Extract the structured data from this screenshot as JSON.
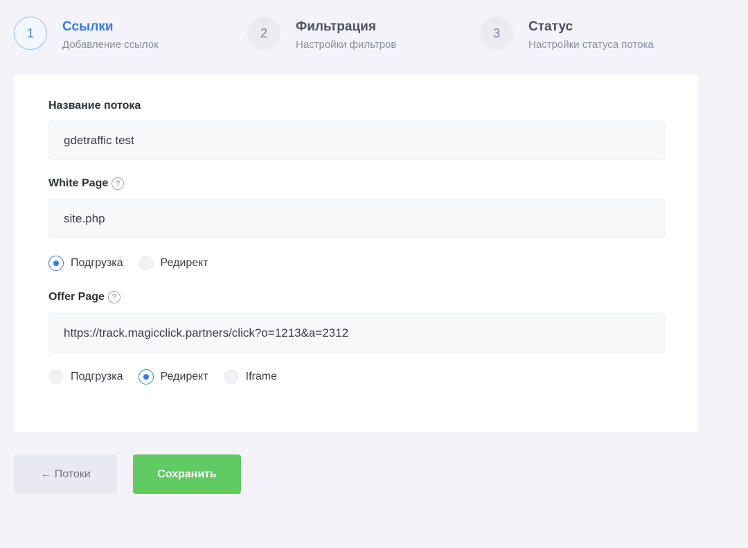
{
  "steps": [
    {
      "number": "1",
      "title": "Ссылки",
      "subtitle": "Добавление ссылок",
      "active": true
    },
    {
      "number": "2",
      "title": "Фильтрация",
      "subtitle": "Настройки фильтров",
      "active": false
    },
    {
      "number": "3",
      "title": "Статус",
      "subtitle": "Настройки статуса потока",
      "active": false
    }
  ],
  "form": {
    "stream_name": {
      "label": "Название потока",
      "value": "gdetraffic test"
    },
    "white_page": {
      "label": "White Page",
      "value": "site.php",
      "options": [
        {
          "label": "Подгрузка",
          "checked": true
        },
        {
          "label": "Редирект",
          "checked": false
        }
      ]
    },
    "offer_page": {
      "label": "Offer Page",
      "value": "https://track.magicclick.partners/click?o=1213&a=2312",
      "options": [
        {
          "label": "Подгрузка",
          "checked": false
        },
        {
          "label": "Редирект",
          "checked": true
        },
        {
          "label": "Iframe",
          "checked": false
        }
      ]
    },
    "help_glyph": "?"
  },
  "buttons": {
    "back_label": "← Потоки",
    "save_label": "Сохранить"
  },
  "colors": {
    "accent": "#3b7ddd",
    "save": "#5fcb62",
    "background": "#f3f3f9"
  },
  "icons": {
    "help": "question-circle-icon"
  }
}
